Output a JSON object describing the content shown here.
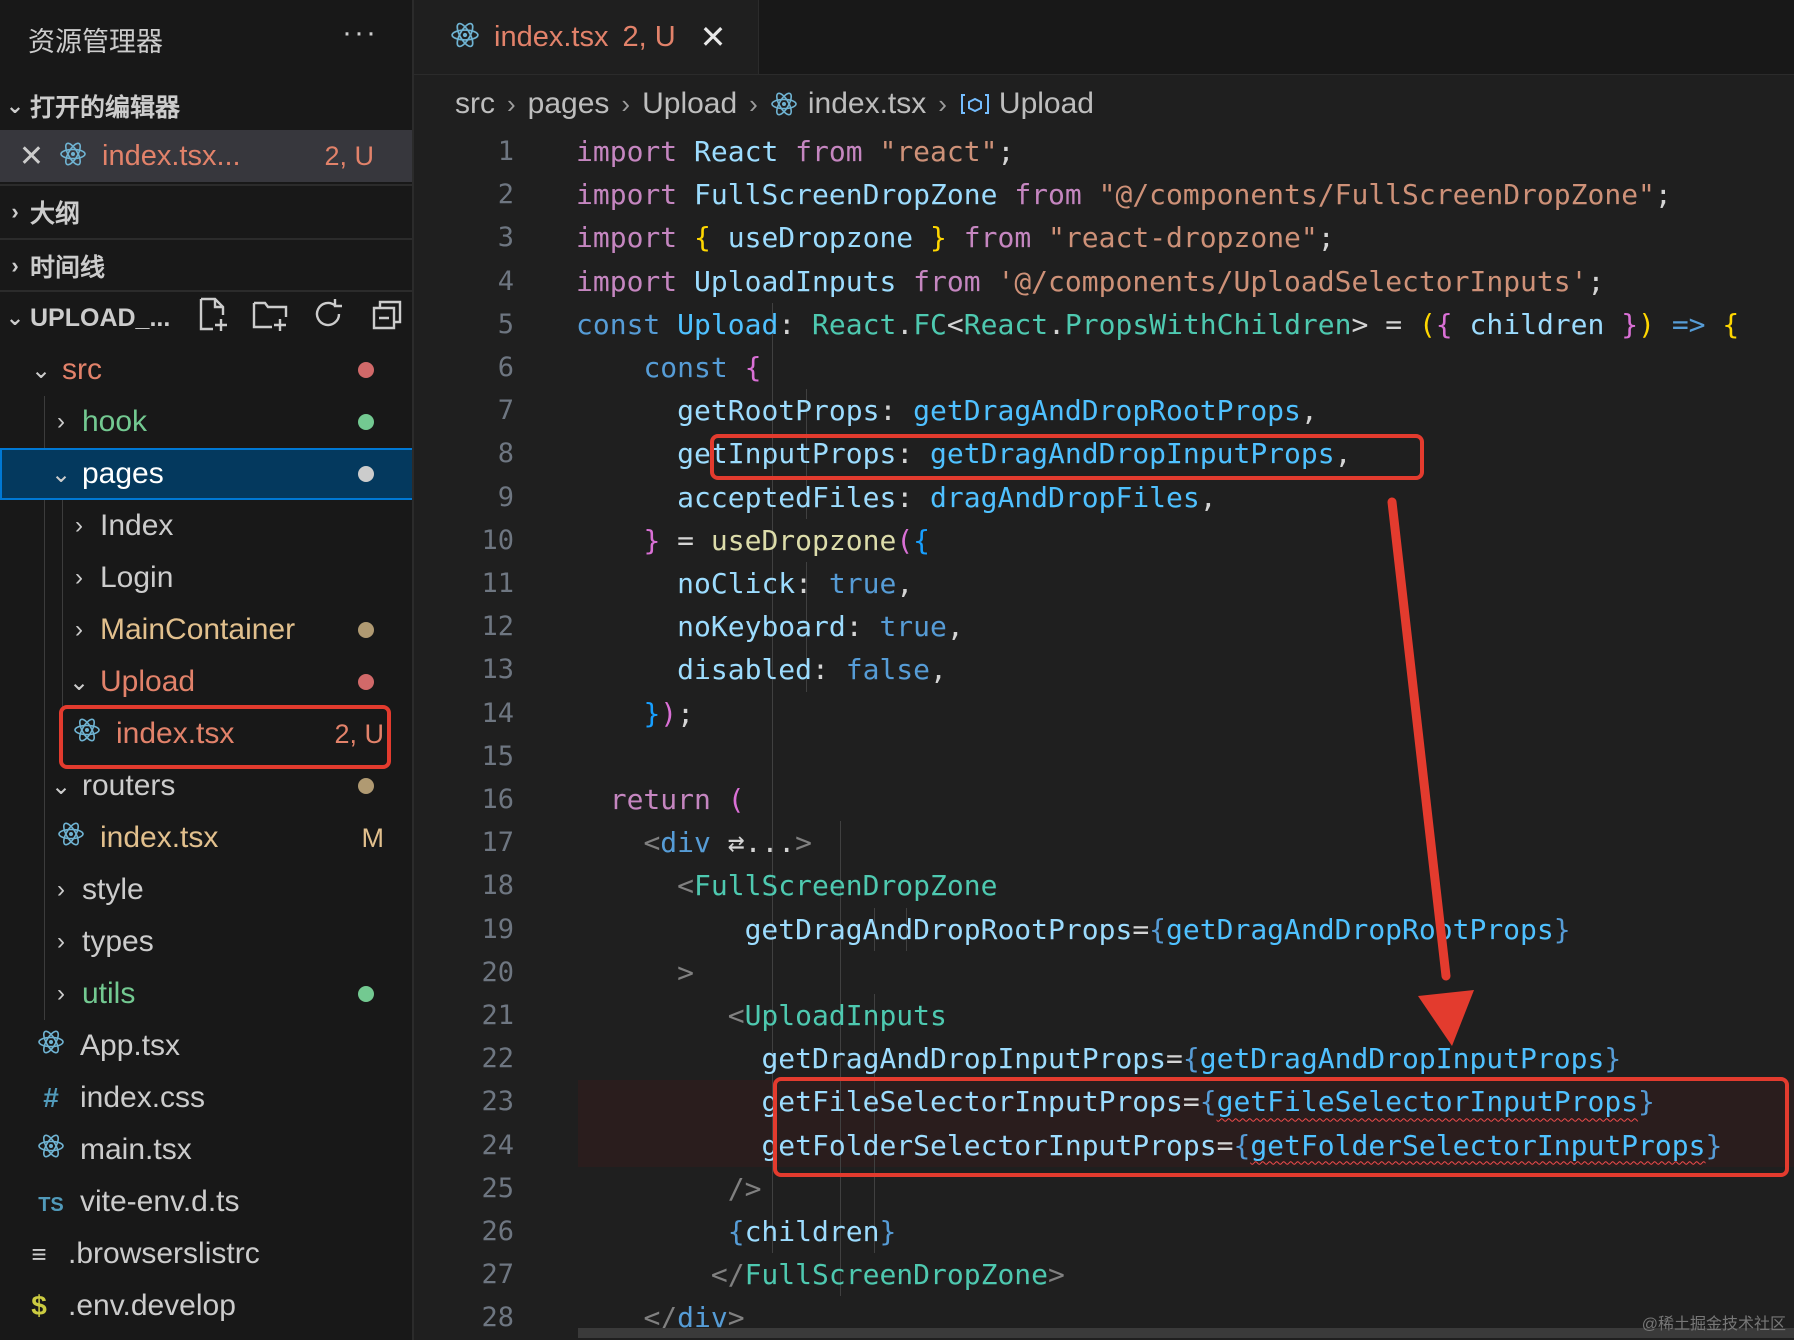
{
  "sidebar": {
    "title": "资源管理器",
    "more": "···",
    "sections": {
      "open_editors": "打开的编辑器",
      "outline": "大纲",
      "timeline": "时间线",
      "project": "UPLOAD_..."
    },
    "open_editor": {
      "name": "index.tsx...",
      "status": "2, U"
    },
    "tree": [
      {
        "label": "src",
        "color": "#e2826a",
        "dot": "#d16969"
      },
      {
        "label": "hook",
        "color": "#73c991",
        "dot": "#73c991"
      },
      {
        "label": "pages",
        "color": "#ffffff",
        "dot": "#cccccc"
      },
      {
        "label": "Index",
        "color": "#cccccc"
      },
      {
        "label": "Login",
        "color": "#cccccc"
      },
      {
        "label": "MainContainer",
        "color": "#e2c08d",
        "dot": "#b09a72"
      },
      {
        "label": "Upload",
        "color": "#e2826a",
        "dot": "#d16969"
      },
      {
        "label": "index.tsx",
        "color": "#e2826a",
        "badge": "2, U"
      },
      {
        "label": "routers",
        "color": "#cccccc",
        "dot": "#b09a72"
      },
      {
        "label": "index.tsx",
        "color": "#e2c08d",
        "badge": "M"
      },
      {
        "label": "style",
        "color": "#cccccc"
      },
      {
        "label": "types",
        "color": "#cccccc"
      },
      {
        "label": "utils",
        "color": "#73c991",
        "dot": "#73c991"
      },
      {
        "label": "App.tsx",
        "color": "#cccccc"
      },
      {
        "label": "index.css",
        "color": "#cccccc"
      },
      {
        "label": "main.tsx",
        "color": "#cccccc"
      },
      {
        "label": "vite-env.d.ts",
        "color": "#cccccc"
      },
      {
        "label": ".browserslistrc",
        "color": "#cccccc"
      },
      {
        "label": ".env.develop",
        "color": "#cccccc"
      }
    ]
  },
  "tab": {
    "name": "index.tsx",
    "status": "2, U",
    "close": "✕"
  },
  "breadcrumb": [
    "src",
    "pages",
    "Upload",
    "index.tsx",
    "Upload"
  ],
  "code_lines": [
    [
      [
        "k",
        "import"
      ],
      [
        "p",
        " "
      ],
      [
        "i",
        "React"
      ],
      [
        "p",
        " "
      ],
      [
        "k",
        "from"
      ],
      [
        "p",
        " "
      ],
      [
        "s",
        "\"react\""
      ],
      [
        "p",
        ";"
      ]
    ],
    [
      [
        "k",
        "import"
      ],
      [
        "p",
        " "
      ],
      [
        "i",
        "FullScreenDropZone"
      ],
      [
        "p",
        " "
      ],
      [
        "k",
        "from"
      ],
      [
        "p",
        " "
      ],
      [
        "s",
        "\"@/components/FullScreenDropZone\""
      ],
      [
        "p",
        ";"
      ]
    ],
    [
      [
        "k",
        "import"
      ],
      [
        "p",
        " "
      ],
      [
        "y",
        "{"
      ],
      [
        "p",
        " "
      ],
      [
        "i",
        "useDropzone"
      ],
      [
        "p",
        " "
      ],
      [
        "y",
        "}"
      ],
      [
        "p",
        " "
      ],
      [
        "k",
        "from"
      ],
      [
        "p",
        " "
      ],
      [
        "s",
        "\"react-dropzone\""
      ],
      [
        "p",
        ";"
      ]
    ],
    [
      [
        "k",
        "import"
      ],
      [
        "p",
        " "
      ],
      [
        "i",
        "UploadInputs"
      ],
      [
        "p",
        " "
      ],
      [
        "k",
        "from"
      ],
      [
        "p",
        " "
      ],
      [
        "s",
        "'@/components/UploadSelectorInputs'"
      ],
      [
        "p",
        ";"
      ]
    ],
    [
      [
        "v",
        "const"
      ],
      [
        "p",
        " "
      ],
      [
        "c2",
        "Upload"
      ],
      [
        "p",
        ": "
      ],
      [
        "t",
        "React"
      ],
      [
        "p",
        "."
      ],
      [
        "t",
        "FC"
      ],
      [
        "p",
        "<"
      ],
      [
        "t",
        "React"
      ],
      [
        "p",
        "."
      ],
      [
        "t",
        "PropsWithChildren"
      ],
      [
        "p",
        "> = "
      ],
      [
        "y",
        "("
      ],
      [
        "m",
        "{"
      ],
      [
        "p",
        " "
      ],
      [
        "i",
        "children"
      ],
      [
        "p",
        " "
      ],
      [
        "m",
        "}"
      ],
      [
        "y",
        ")"
      ],
      [
        "p",
        " "
      ],
      [
        "v",
        "=>"
      ],
      [
        "p",
        " "
      ],
      [
        "y",
        "{"
      ]
    ],
    [
      [
        "p",
        "    "
      ],
      [
        "v",
        "const"
      ],
      [
        "p",
        " "
      ],
      [
        "m",
        "{"
      ]
    ],
    [
      [
        "p",
        "      "
      ],
      [
        "i",
        "getRootProps"
      ],
      [
        "p",
        ": "
      ],
      [
        "c2",
        "getDragAndDropRootProps"
      ],
      [
        "p",
        ","
      ]
    ],
    [
      [
        "p",
        "      "
      ],
      [
        "i",
        "getInputProps"
      ],
      [
        "p",
        ": "
      ],
      [
        "c2",
        "getDragAndDropInputProps"
      ],
      [
        "p",
        ","
      ]
    ],
    [
      [
        "p",
        "      "
      ],
      [
        "i",
        "acceptedFiles"
      ],
      [
        "p",
        ": "
      ],
      [
        "c2",
        "dragAndDropFiles"
      ],
      [
        "p",
        ","
      ]
    ],
    [
      [
        "p",
        "    "
      ],
      [
        "m",
        "}"
      ],
      [
        "p",
        " = "
      ],
      [
        "f",
        "useDropzone"
      ],
      [
        "m",
        "("
      ],
      [
        "b",
        "{"
      ]
    ],
    [
      [
        "p",
        "      "
      ],
      [
        "i",
        "noClick"
      ],
      [
        "p",
        ": "
      ],
      [
        "v",
        "true"
      ],
      [
        "p",
        ","
      ]
    ],
    [
      [
        "p",
        "      "
      ],
      [
        "i",
        "noKeyboard"
      ],
      [
        "p",
        ": "
      ],
      [
        "v",
        "true"
      ],
      [
        "p",
        ","
      ]
    ],
    [
      [
        "p",
        "      "
      ],
      [
        "i",
        "disabled"
      ],
      [
        "p",
        ": "
      ],
      [
        "v",
        "false"
      ],
      [
        "p",
        ","
      ]
    ],
    [
      [
        "p",
        "    "
      ],
      [
        "b",
        "}"
      ],
      [
        "m",
        ")"
      ],
      [
        "p",
        ";"
      ]
    ],
    [
      [
        "p",
        ""
      ]
    ],
    [
      [
        "p",
        "  "
      ],
      [
        "k",
        "return"
      ],
      [
        "p",
        " "
      ],
      [
        "m",
        "("
      ]
    ],
    [
      [
        "p",
        "    "
      ],
      [
        "g",
        "<"
      ],
      [
        "v",
        "div"
      ],
      [
        "p",
        " ⇄..."
      ],
      [
        "g",
        ">"
      ]
    ],
    [
      [
        "p",
        "      "
      ],
      [
        "g",
        "<"
      ],
      [
        "t",
        "FullScreenDropZone"
      ]
    ],
    [
      [
        "p",
        "          "
      ],
      [
        "i",
        "getDragAndDropRootProps"
      ],
      [
        "p",
        "="
      ],
      [
        "v",
        "{"
      ],
      [
        "c2",
        "getDragAndDropRootProps"
      ],
      [
        "v",
        "}"
      ]
    ],
    [
      [
        "p",
        "      "
      ],
      [
        "g",
        ">"
      ]
    ],
    [
      [
        "p",
        "         "
      ],
      [
        "g",
        "<"
      ],
      [
        "t",
        "UploadInputs"
      ]
    ],
    [
      [
        "p",
        "           "
      ],
      [
        "i",
        "getDragAndDropInputProps"
      ],
      [
        "p",
        "="
      ],
      [
        "v",
        "{"
      ],
      [
        "c2",
        "getDragAndDropInputProps"
      ],
      [
        "v",
        "}"
      ]
    ],
    [
      [
        "p",
        "           "
      ],
      [
        "i",
        "getFileSelectorInputProps"
      ],
      [
        "p",
        "="
      ],
      [
        "v",
        "{"
      ],
      [
        "c2 sq",
        "getFileSelectorInputProps"
      ],
      [
        "v",
        "}"
      ]
    ],
    [
      [
        "p",
        "           "
      ],
      [
        "i",
        "getFolderSelectorInputProps"
      ],
      [
        "p",
        "="
      ],
      [
        "v",
        "{"
      ],
      [
        "c2 sq",
        "getFolderSelectorInputProps"
      ],
      [
        "v",
        "}"
      ]
    ],
    [
      [
        "p",
        "         "
      ],
      [
        "g",
        "/>"
      ]
    ],
    [
      [
        "p",
        "         "
      ],
      [
        "v",
        "{"
      ],
      [
        "i",
        "children"
      ],
      [
        "v",
        "}"
      ]
    ],
    [
      [
        "p",
        "        "
      ],
      [
        "g",
        "</"
      ],
      [
        "t",
        "FullScreenDropZone"
      ],
      [
        "g",
        ">"
      ]
    ],
    [
      [
        "p",
        "    "
      ],
      [
        "g",
        "</"
      ],
      [
        "v",
        "div"
      ],
      [
        "g",
        ">"
      ]
    ]
  ],
  "watermark": "@稀土掘金技术社区"
}
